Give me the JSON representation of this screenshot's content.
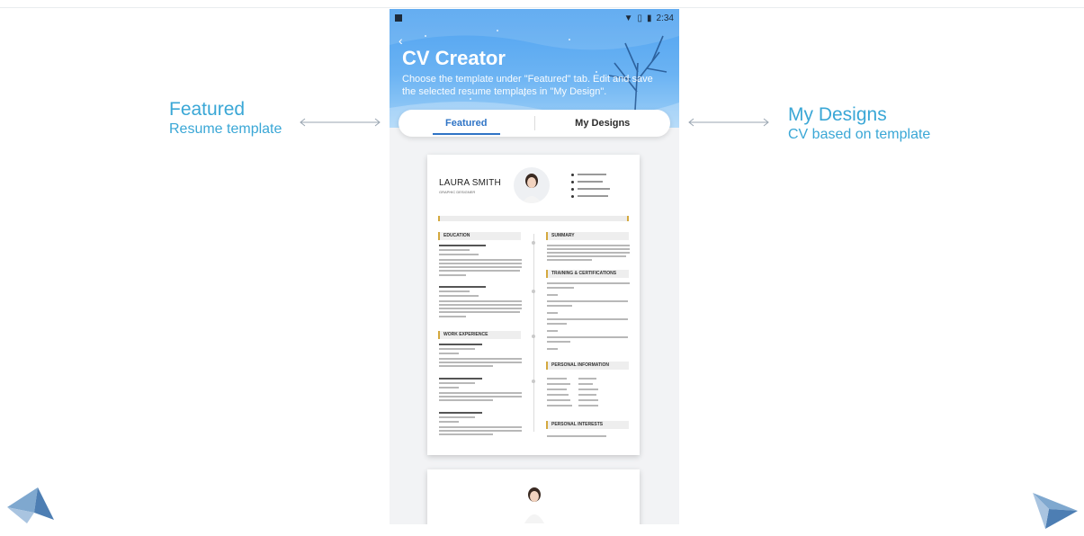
{
  "phone": {
    "status": {
      "time": "2:34"
    },
    "header": {
      "title": "CV Creator",
      "description": "Choose the template under \"Featured\" tab. Edit and save the selected resume templates in \"My Design\"."
    },
    "tabs": [
      {
        "label": "Featured",
        "active": true
      },
      {
        "label": "My Designs",
        "active": false
      }
    ]
  },
  "resume": {
    "name": "LAURA SMITH",
    "role": "GRAPHIC DESIGNER",
    "sections": {
      "education": "EDUCATION",
      "work": "WORK EXPERIENCE",
      "summary": "SUMMARY",
      "training": "TRAINING & CERTIFICATIONS",
      "personal_info": "PERSONAL INFORMATION",
      "personal_interests": "PERSONAL INTERESTS"
    }
  },
  "annotations": {
    "left": {
      "title": "Featured",
      "subtitle": "Resume template"
    },
    "right": {
      "title": "My Designs",
      "subtitle": "CV based on template"
    }
  },
  "colors": {
    "accent": "#3aa7d6",
    "header_blue": "#4fa2f0",
    "tab_active": "#2f74c6",
    "resume_gold": "#d4a93f"
  },
  "icons": {
    "back": "chevron-left-icon",
    "wifi": "wifi-icon",
    "battery": "battery-icon",
    "arrows": "double-arrow-icon"
  }
}
